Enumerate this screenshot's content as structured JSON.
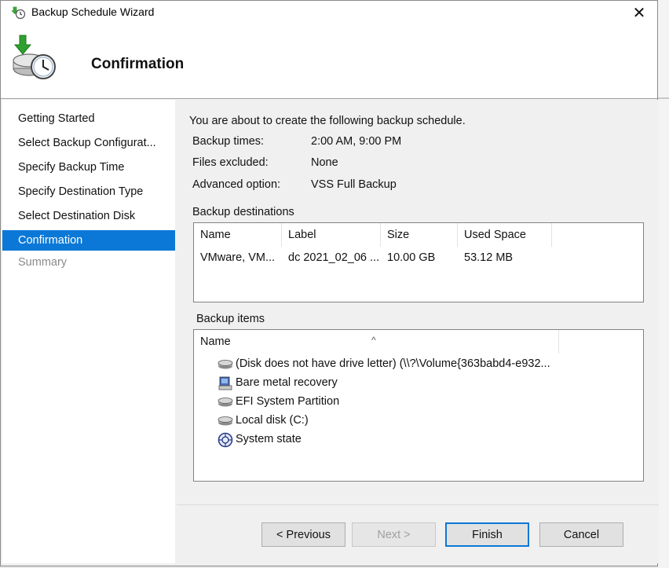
{
  "window": {
    "title": "Backup Schedule Wizard",
    "close_glyph": "✕"
  },
  "header": {
    "title": "Confirmation",
    "icon": "backup-clock-icon"
  },
  "steps": [
    {
      "label": "Getting Started",
      "state": "done"
    },
    {
      "label": "Select Backup Configurat...",
      "state": "done"
    },
    {
      "label": "Specify Backup Time",
      "state": "done"
    },
    {
      "label": "Specify Destination Type",
      "state": "done"
    },
    {
      "label": "Select Destination Disk",
      "state": "done"
    },
    {
      "label": "Confirmation",
      "state": "active"
    },
    {
      "label": "Summary",
      "state": "disabled"
    }
  ],
  "summary": {
    "intro": "You are about to create the following backup schedule.",
    "rows": [
      {
        "label": "Backup times:",
        "value": "2:00 AM, 9:00 PM"
      },
      {
        "label": "Files excluded:",
        "value": "None"
      },
      {
        "label": "Advanced option:",
        "value": "VSS Full Backup"
      }
    ]
  },
  "destinations": {
    "label": "Backup destinations",
    "columns": [
      "Name",
      "Label",
      "Size",
      "Used Space"
    ],
    "rows": [
      [
        "VMware, VM...",
        "dc 2021_02_06 ...",
        "10.00 GB",
        "53.12 MB"
      ]
    ]
  },
  "items": {
    "label": "Backup items",
    "column": "Name",
    "sort_glyph": "^",
    "entries": [
      {
        "label": "(Disk does not have drive letter) (\\\\?\\Volume{363babd4-e932...",
        "icon": "disk-icon"
      },
      {
        "label": "Bare metal recovery",
        "icon": "server-icon"
      },
      {
        "label": "EFI System Partition",
        "icon": "disk-icon"
      },
      {
        "label": "Local disk (C:)",
        "icon": "disk-icon"
      },
      {
        "label": "System state",
        "icon": "system-state-icon"
      }
    ]
  },
  "buttons": {
    "previous": "< Previous",
    "next": "Next >",
    "finish": "Finish",
    "cancel": "Cancel"
  },
  "colors": {
    "accent": "#0b78d7"
  }
}
